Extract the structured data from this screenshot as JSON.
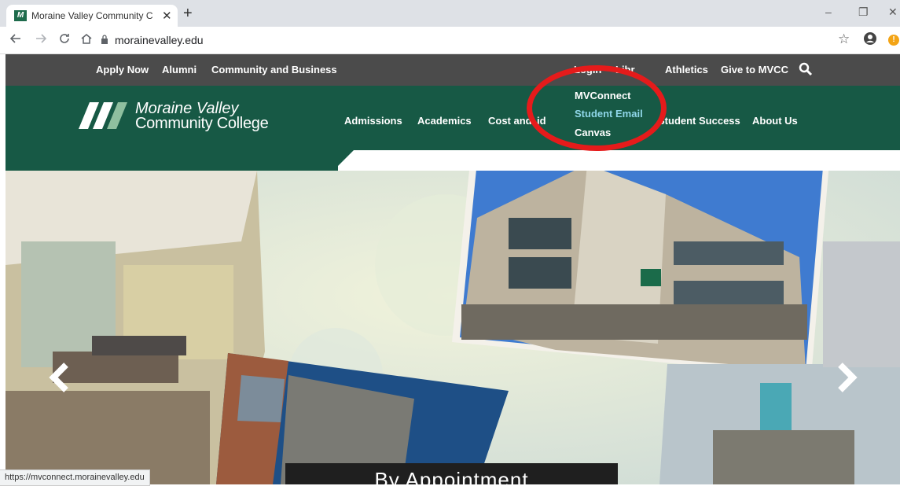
{
  "browser": {
    "tab_title": "Moraine Valley Community Colle",
    "tab_close": "✕",
    "new_tab": "+",
    "url": "morainevalley.edu",
    "window_controls": {
      "minimize": "–",
      "restore": "❐",
      "close": "✕"
    },
    "icons": {
      "back": "arrow-left-icon",
      "forward": "arrow-right-icon",
      "reload": "reload-icon",
      "home": "home-icon",
      "star": "star-icon",
      "profile": "profile-icon"
    },
    "extension_badge": "!"
  },
  "utility_nav": {
    "left": [
      "Apply Now",
      "Alumni",
      "Community and Business"
    ],
    "right": [
      "Login",
      "Libr",
      "Athletics",
      "Give to MVCC"
    ],
    "search_icon": "search-icon"
  },
  "logo": {
    "line1": "Moraine Valley",
    "line2": "Community College"
  },
  "main_nav": [
    "Admissions",
    "Academics",
    "Cost and",
    "id",
    "Student Success",
    "About Us"
  ],
  "login_dropdown": [
    "MVConnect",
    "Student Email",
    "Canvas"
  ],
  "hero": {
    "caption": "By Appointment",
    "prev_icon": "chevron-left-icon",
    "next_icon": "chevron-right-icon"
  },
  "status_url": "https://mvconnect.morainevalley.edu",
  "colors": {
    "brand_green": "#175945",
    "utility_gray": "#4b4b4b",
    "highlight": "#e51b1b",
    "active_link": "#8fd6e8"
  }
}
